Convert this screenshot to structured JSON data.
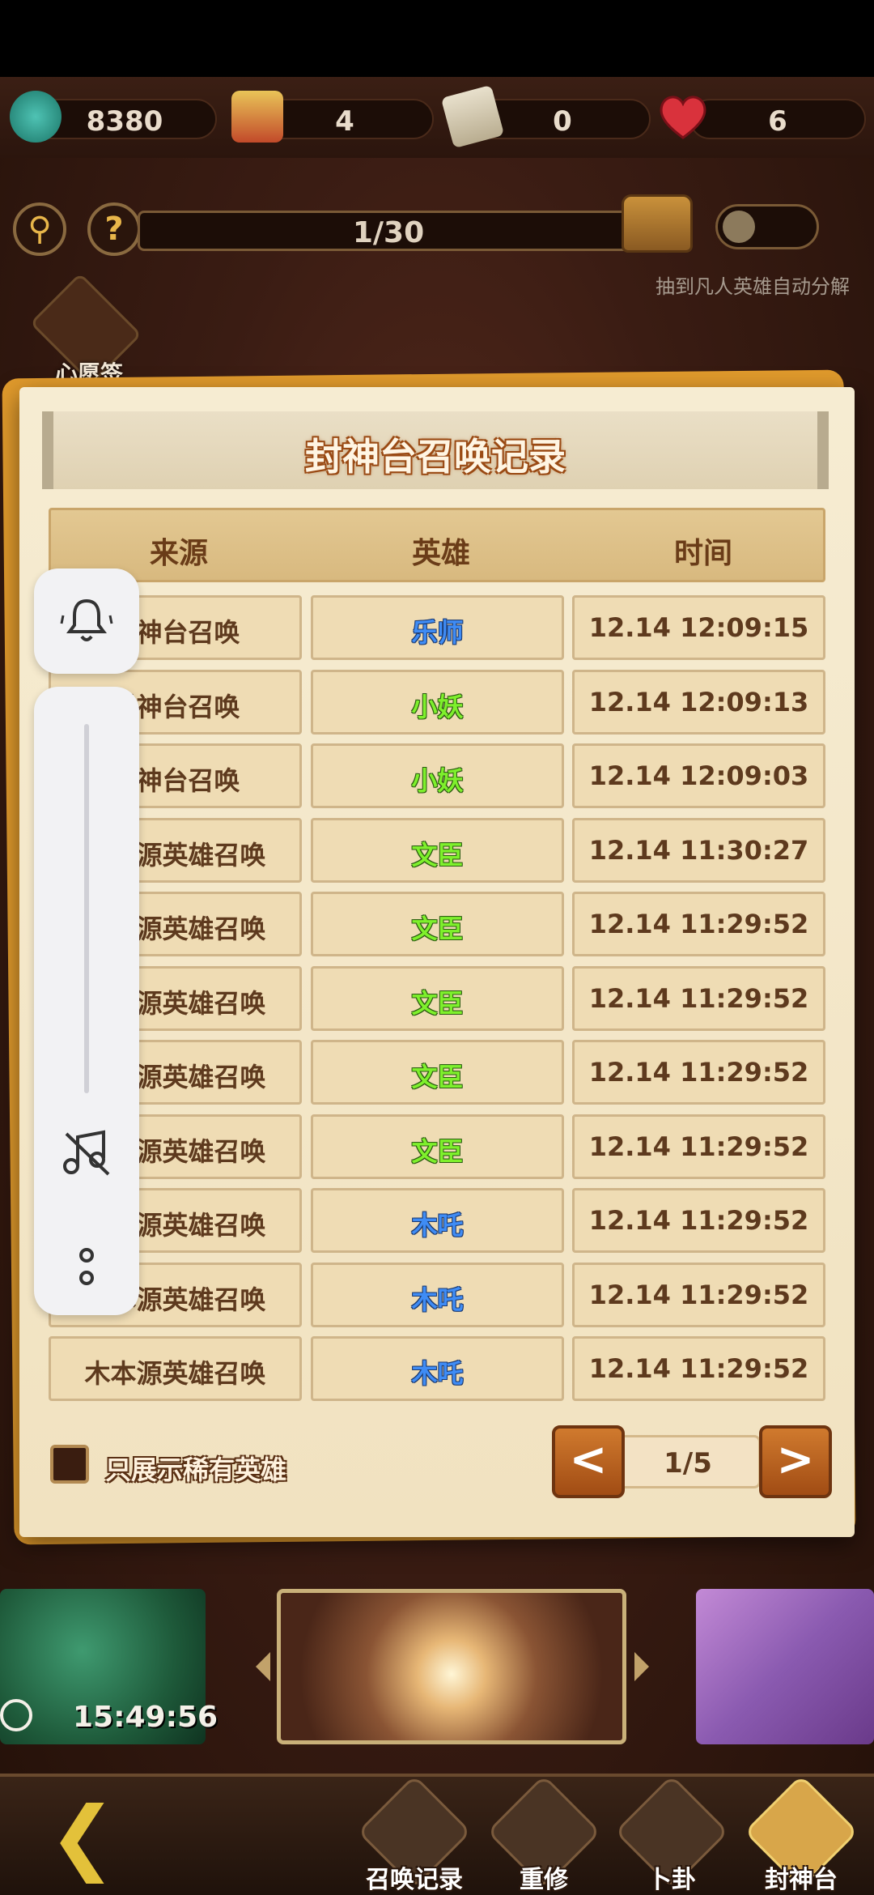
{
  "currencies": [
    {
      "icon": "jade-coin-icon",
      "value": "8380"
    },
    {
      "icon": "scroll-ticket-icon",
      "value": "4"
    },
    {
      "icon": "talisman-icon",
      "value": "0"
    },
    {
      "icon": "heart-icon",
      "value": "6"
    }
  ],
  "top_controls": {
    "search_icon": "search-icon",
    "help_icon": "?",
    "progress_text": "1/30",
    "progress_value": 0.033,
    "auto_decompose_label": "抽到凡人英雄自动分解",
    "toggle_on": false
  },
  "wish": {
    "label": "心愿签"
  },
  "dialog": {
    "title": "封神台召唤记录",
    "headers": [
      "来源",
      "英雄",
      "时间"
    ],
    "rows": [
      {
        "source": "封神台召唤",
        "hero": "乐师",
        "hero_color": "blue",
        "time": "12.14 12:09:15"
      },
      {
        "source": "封神台召唤",
        "hero": "小妖",
        "hero_color": "green",
        "time": "12.14 12:09:13"
      },
      {
        "source": "封神台召唤",
        "hero": "小妖",
        "hero_color": "green",
        "time": "12.14 12:09:03"
      },
      {
        "source": "木本源英雄召唤",
        "hero": "文臣",
        "hero_color": "green",
        "time": "12.14 11:30:27"
      },
      {
        "source": "木本源英雄召唤",
        "hero": "文臣",
        "hero_color": "green",
        "time": "12.14 11:29:52"
      },
      {
        "source": "木本源英雄召唤",
        "hero": "文臣",
        "hero_color": "green",
        "time": "12.14 11:29:52"
      },
      {
        "source": "木本源英雄召唤",
        "hero": "文臣",
        "hero_color": "green",
        "time": "12.14 11:29:52"
      },
      {
        "source": "木本源英雄召唤",
        "hero": "文臣",
        "hero_color": "green",
        "time": "12.14 11:29:52"
      },
      {
        "source": "木本源英雄召唤",
        "hero": "木吒",
        "hero_color": "blue",
        "time": "12.14 11:29:52"
      },
      {
        "source": "木本源英雄召唤",
        "hero": "木吒",
        "hero_color": "blue",
        "time": "12.14 11:29:52"
      },
      {
        "source": "木本源英雄召唤",
        "hero": "木吒",
        "hero_color": "blue",
        "time": "12.14 11:29:52"
      }
    ],
    "rare_only_label": "只展示稀有英雄",
    "rare_only_checked": false,
    "pagination": {
      "current": "1/5",
      "prev": "<",
      "next": ">"
    }
  },
  "bottom_banners": {
    "timer": "15:49:56"
  },
  "bottom_nav": {
    "items": [
      {
        "label": "召唤记录",
        "icon": "record-scroll-icon"
      },
      {
        "label": "重修",
        "icon": "monk-icon"
      },
      {
        "label": "卜卦",
        "icon": "yin-yang-icon"
      },
      {
        "label": "封神台",
        "icon": "altar-icon"
      }
    ]
  },
  "system_panel": {
    "icons": [
      "bell-icon",
      "music-off-icon",
      "more-icon"
    ]
  },
  "colors": {
    "hero_blue": "#3f8cf5",
    "hero_green": "#7ef02c",
    "accent": "#e09a2c"
  }
}
